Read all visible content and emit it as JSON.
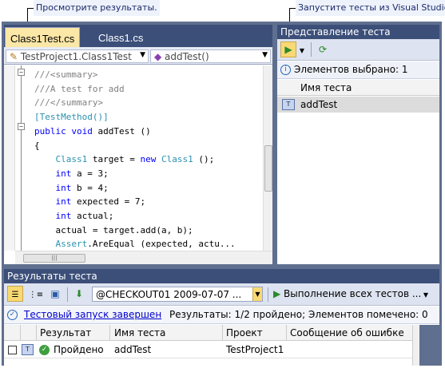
{
  "callouts": {
    "left": "Просмотрите результаты.",
    "right": "Запустите тесты из Visual Studio."
  },
  "editor": {
    "tabs": [
      {
        "label": "Class1Test.cs",
        "active": true
      },
      {
        "label": "Class1.cs",
        "active": false
      }
    ],
    "class_combo": "TestProject1.Class1Test",
    "member_combo": "addTest()",
    "code_lines": [
      [
        "///<summary>"
      ],
      [
        "///A test for add"
      ],
      [
        "///</summary>"
      ],
      [
        "[TestMethod()]"
      ],
      [
        "public",
        " ",
        "void",
        " addTest ()"
      ],
      [
        "{"
      ],
      [
        "    ",
        "Class1",
        " target = ",
        "new",
        " ",
        "Class1",
        " ();"
      ],
      [
        "    ",
        "int",
        " a = 3;"
      ],
      [
        "    ",
        "int",
        " b = 4;"
      ],
      [
        "    ",
        "int",
        " expected = 7;"
      ],
      [
        "    ",
        "int",
        " actual;"
      ],
      [
        "    actual = target.add(a, b);"
      ],
      [
        "    ",
        "Assert",
        ".AreEqual (expected, actu..."
      ]
    ]
  },
  "test_view": {
    "title": "Представление теста",
    "status": "Элементов выбрано: 1",
    "column_header": "Имя теста",
    "rows": [
      {
        "name": "addTest"
      }
    ]
  },
  "results": {
    "title": "Результаты теста",
    "run_selector": "@CHECKOUT01 2009-07-07 ...",
    "run_all_label": "Выполнение всех тестов ...",
    "status_link": "Тестовый запуск завершен",
    "status_text": "Результаты: 1/2 пройдено;  Элементов помечено: 0",
    "columns": [
      "Результат",
      "Имя теста",
      "Проект",
      "Сообщение об ошибке"
    ],
    "rows": [
      {
        "result": "Пройдено",
        "test_name": "addTest",
        "project": "TestProject1",
        "error": ""
      }
    ]
  },
  "colors": {
    "frame": "#5f6f8f",
    "title_bar": "#3c4f79",
    "active_tab": "#fbe7a6",
    "toolbar": "#dde3f0",
    "button_highlight": "#f9d973",
    "comment": "#808080",
    "keyword": "#0000ff",
    "type": "#2b91af",
    "attribute": "#008000",
    "pass": "#3f9f3f",
    "link": "#0000cc"
  },
  "icons": {
    "left_callout_target": "list-results-icon",
    "right_callout_target": "run-tests-icon",
    "pass_status": "check-circle-icon",
    "completed_status": "check-icon"
  }
}
